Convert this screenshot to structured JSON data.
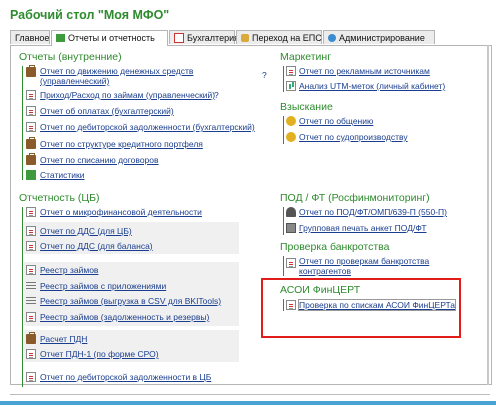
{
  "title": "Рабочий стол \"Моя МФО\"",
  "tabs": [
    {
      "label": "Главное",
      "icon": "none"
    },
    {
      "label": "Отчеты и отчетность",
      "icon": "chart-icon"
    },
    {
      "label": "Бухгалтерия",
      "icon": "calendar-icon"
    },
    {
      "label": "Переход на ЕПС",
      "icon": "puzzle-icon"
    },
    {
      "label": "Администрирование",
      "icon": "gear-icon"
    }
  ],
  "left": {
    "internal_title": "Отчеты (внутренние)",
    "internal_links": [
      {
        "label": "Отчет по движению денежных средств",
        "icon": "briefcase-icon"
      },
      {
        "label": "(управленческий)",
        "icon": "none"
      },
      {
        "label": "Приход/Расход по займам (управленческий)",
        "icon": "document-icon"
      },
      {
        "label": "Отчет об оплатах (бухгалтерский)",
        "icon": "document-icon"
      },
      {
        "label": "Отчет по дебиторской задолженности (бухгалтерский)",
        "icon": "document-icon"
      },
      {
        "label": "Отчет по структуре кредитного портфеля",
        "icon": "briefcase-icon"
      },
      {
        "label": "Отчет по списанию договоров",
        "icon": "briefcase-icon"
      },
      {
        "label": "Статистики",
        "icon": "chart-icon"
      }
    ],
    "question_marks": [
      "?",
      "?"
    ],
    "cb_title": "Отчетность (ЦБ)",
    "cb_links": [
      {
        "label": "Отчет о микрофинансовой деятельности",
        "icon": "document-icon"
      },
      {
        "label": "Отчет по ДДС (для ЦБ)",
        "icon": "document-icon"
      },
      {
        "label": "Отчет по ДДС (для баланса)",
        "icon": "document-icon"
      },
      {
        "label": "Реестр займов",
        "icon": "document-icon"
      },
      {
        "label": "Реестр займов с приложениями",
        "icon": "list-icon"
      },
      {
        "label": "Реестр займов (выгрузка в CSV для BKITools)",
        "icon": "list-icon"
      },
      {
        "label": "Реестр займов (задолженность и резервы)",
        "icon": "document-icon"
      },
      {
        "label": "Расчет ПДН",
        "icon": "briefcase-icon"
      },
      {
        "label": "Отчет ПДН-1 (по форме СРО)",
        "icon": "document-icon"
      },
      {
        "label": "Отчет по дебиторской задолженности в ЦБ",
        "icon": "document-icon"
      }
    ]
  },
  "right": {
    "marketing_title": "Маркетинг",
    "marketing_links": [
      {
        "label": "Отчет по рекламным источникам",
        "icon": "document-icon"
      },
      {
        "label": "Анализ UTM-меток (личный кабинет)",
        "icon": "chart-icon"
      }
    ],
    "collection_title": "Взыскание",
    "collection_links": [
      {
        "label": "Отчет по общению",
        "icon": "coin-icon"
      },
      {
        "label": "Отчет по судопроизводству",
        "icon": "coin-icon"
      }
    ],
    "pod_title": "ПОД / ФТ (Росфинмониторинг)",
    "pod_links": [
      {
        "label": "Отчет по ПОД/ФТ/ОМП/639-П (550-П)",
        "icon": "person-icon"
      },
      {
        "label": "Групповая печать анкет ПОД/ФТ",
        "icon": "printer-icon"
      }
    ],
    "bank_title": "Проверка банкротства",
    "bank_links": [
      {
        "label": "Отчет по проверкам банкротства",
        "icon": "document-icon"
      },
      {
        "label": "контрагентов",
        "icon": "none"
      }
    ],
    "asoi_title": "АСОИ ФинЦЕРТ",
    "asoi_links": [
      {
        "label": "Проверка по спискам АСОИ ФинЦЕРТа",
        "icon": "document-icon"
      }
    ]
  }
}
